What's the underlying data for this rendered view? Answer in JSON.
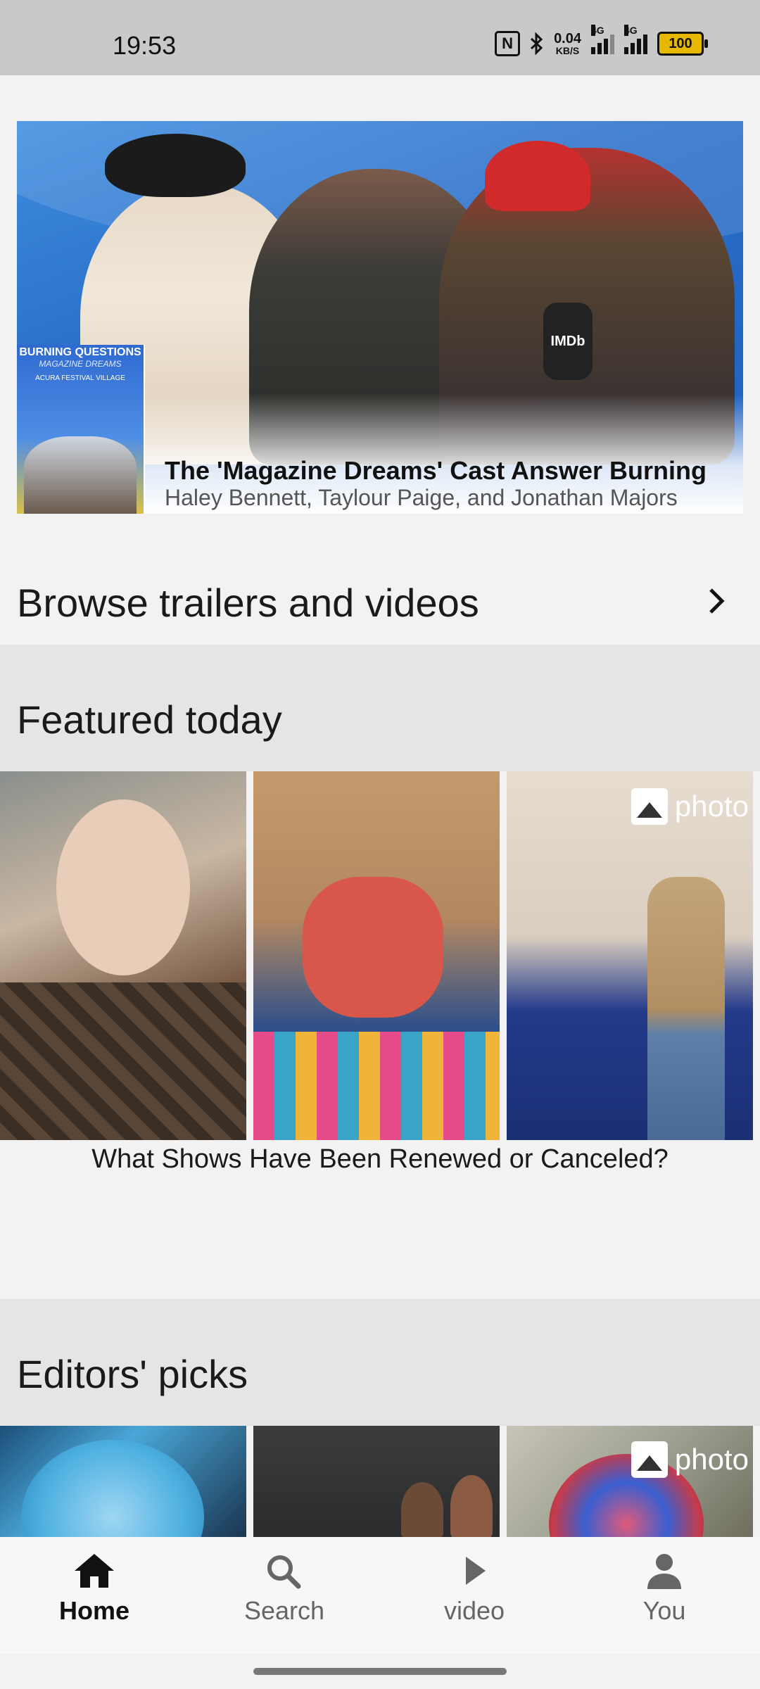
{
  "status_bar": {
    "time": "19:53",
    "network_speed_value": "0.04",
    "network_speed_unit": "KB/S",
    "signal_label_1": "4G",
    "signal_label_2": "4G",
    "battery": "100",
    "icons": [
      "nfc-icon",
      "bluetooth-icon",
      "signal-icon",
      "signal-icon",
      "battery-icon"
    ]
  },
  "hero": {
    "title": "The 'Magazine Dreams' Cast Answer Burning",
    "subtitle": "Haley Bennett, Taylour Paige, and Jonathan Majors",
    "mic_text": "IMDb",
    "poster": {
      "title": "BURNING QUESTIONS",
      "subtitle": "MAGAZINE DREAMS",
      "festival": "ACURA FESTIVAL VILLAGE"
    }
  },
  "browse": {
    "label": "Browse trailers and videos"
  },
  "featured": {
    "title": "Featured today",
    "badge": "photo",
    "caption": "What Shows Have Been Renewed or Canceled?"
  },
  "editors": {
    "title": "Editors' picks",
    "badge": "photo"
  },
  "nav": {
    "items": [
      {
        "label": "Home",
        "icon": "home-icon"
      },
      {
        "label": "Search",
        "icon": "search-icon"
      },
      {
        "label": "video",
        "icon": "play-icon"
      },
      {
        "label": "You",
        "icon": "person-icon"
      }
    ]
  },
  "colors": {
    "hero_blue": "#2a6fc8",
    "section_bg": "#e5e5e5",
    "battery": "#e6b800"
  }
}
